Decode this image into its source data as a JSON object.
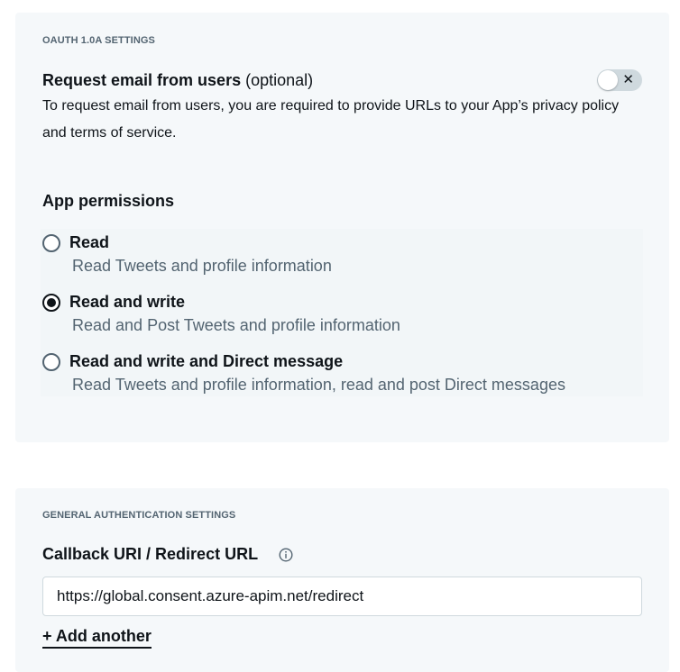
{
  "oauth": {
    "section_label": "OAUTH 1.0A SETTINGS",
    "request_email": {
      "title": "Request email from users",
      "optional": "(optional)",
      "description": "To request email from users, you are required to provide URLs to your App’s privacy policy and terms of service.",
      "toggle_on": false,
      "toggle_icon": "✕"
    },
    "permissions": {
      "title": "App permissions",
      "selected": "Read and write",
      "options": [
        {
          "label": "Read",
          "description": "Read Tweets and profile information"
        },
        {
          "label": "Read and write",
          "description": "Read and Post Tweets and profile information"
        },
        {
          "label": "Read and write and Direct message",
          "description": "Read Tweets and profile information, read and post Direct messages"
        }
      ]
    }
  },
  "general": {
    "section_label": "GENERAL AUTHENTICATION SETTINGS",
    "callback": {
      "title": "Callback URI / Redirect URL",
      "info_icon": "info-icon",
      "value": "https://global.consent.azure-apim.net/redirect"
    },
    "add_another_label": "+ Add another"
  },
  "colors": {
    "card_bg": "#f5f8fa",
    "text_primary": "#0f1419",
    "text_secondary": "#536471",
    "border": "#cfd9de"
  }
}
